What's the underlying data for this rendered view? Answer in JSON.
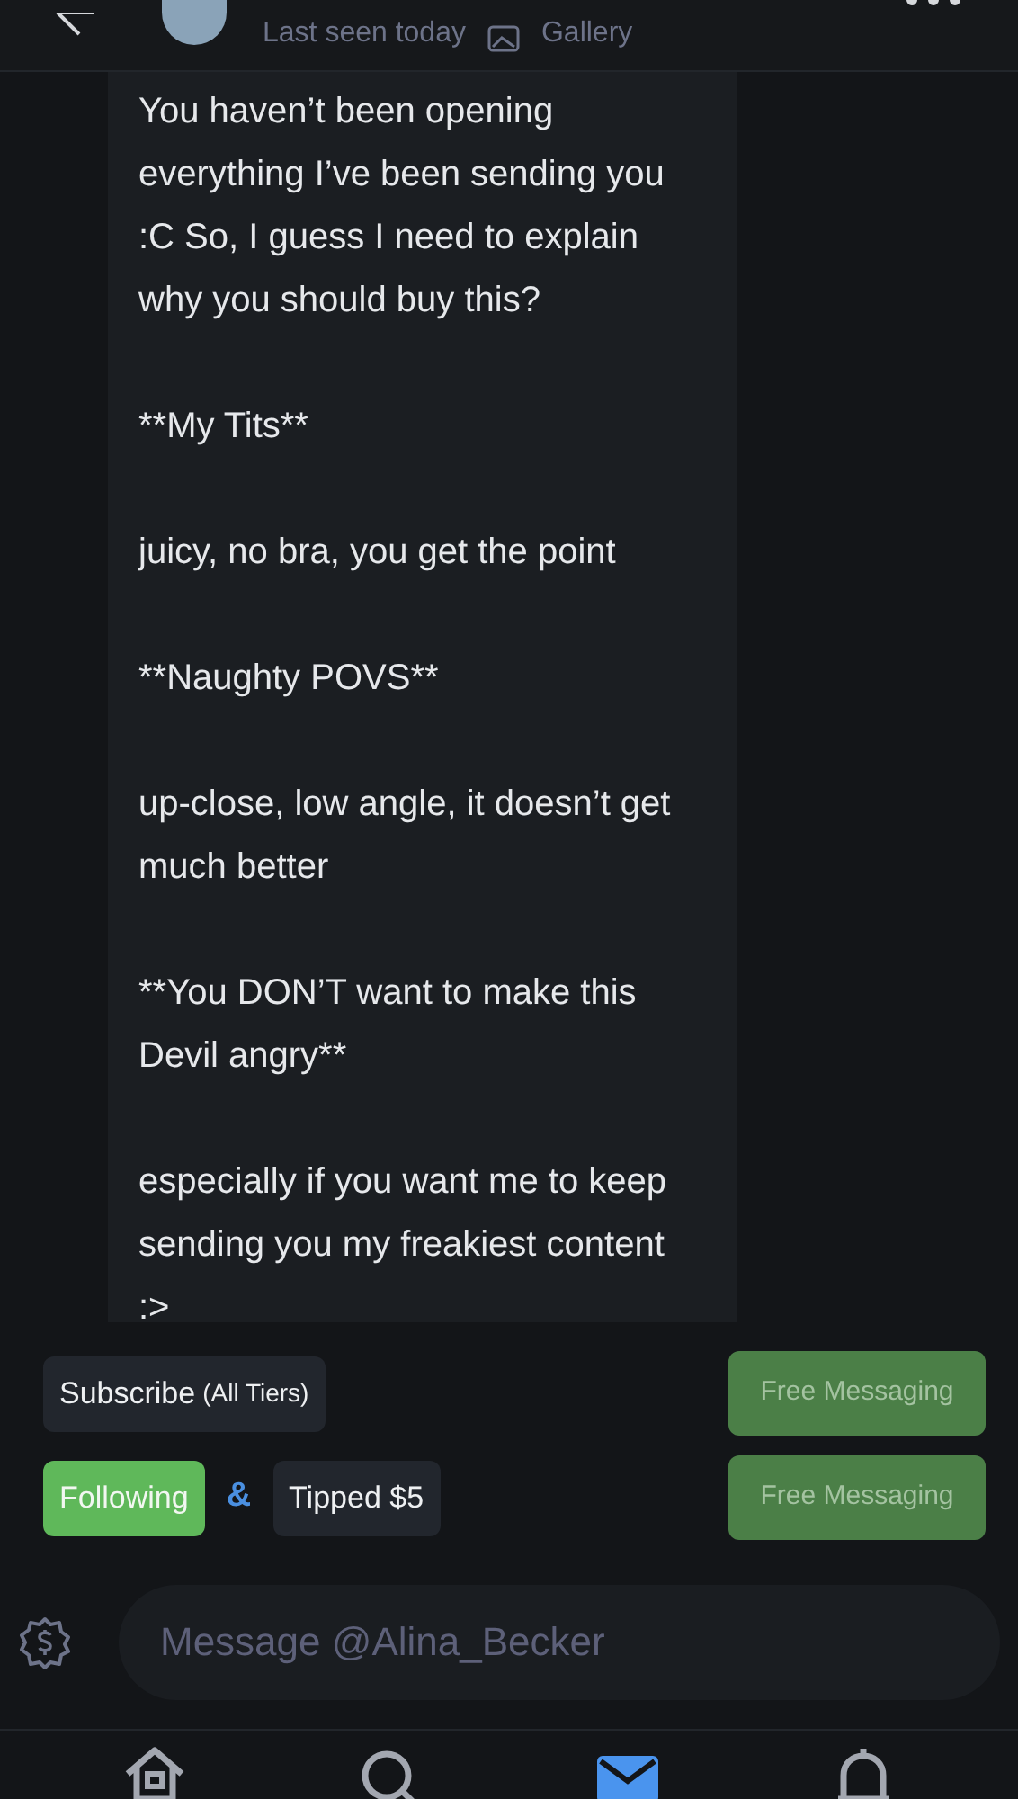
{
  "header": {
    "status": "Last seen today",
    "gallery_label": "Gallery"
  },
  "message": {
    "paragraphs": [
      "You haven’t been opening everything I’ve been sending you :C So, I guess I need to explain why you should buy this?",
      "**My Tits**",
      "juicy, no bra, you get the point",
      "**Naughty POVS**",
      "up-close, low angle, it doesn’t get much better",
      "**You DON’T want to make this Devil angry**",
      "especially if you want me to keep sending you my freakiest content :>"
    ]
  },
  "subscribe_button": {
    "label": "Subscribe",
    "note": "(All Tiers)"
  },
  "following_button": {
    "label": "Following"
  },
  "connector": "&",
  "tipped_button": {
    "label": "Tipped",
    "amount": "$5"
  },
  "free_messaging_buttons": [
    "Free Messaging",
    "Free Messaging"
  ],
  "composer": {
    "placeholder": "Message @Alina_Becker"
  },
  "nav": [
    {
      "kind": "home",
      "selected": false
    },
    {
      "kind": "search",
      "selected": false
    },
    {
      "kind": "messages",
      "selected": true
    },
    {
      "kind": "notifications",
      "selected": false
    }
  ]
}
